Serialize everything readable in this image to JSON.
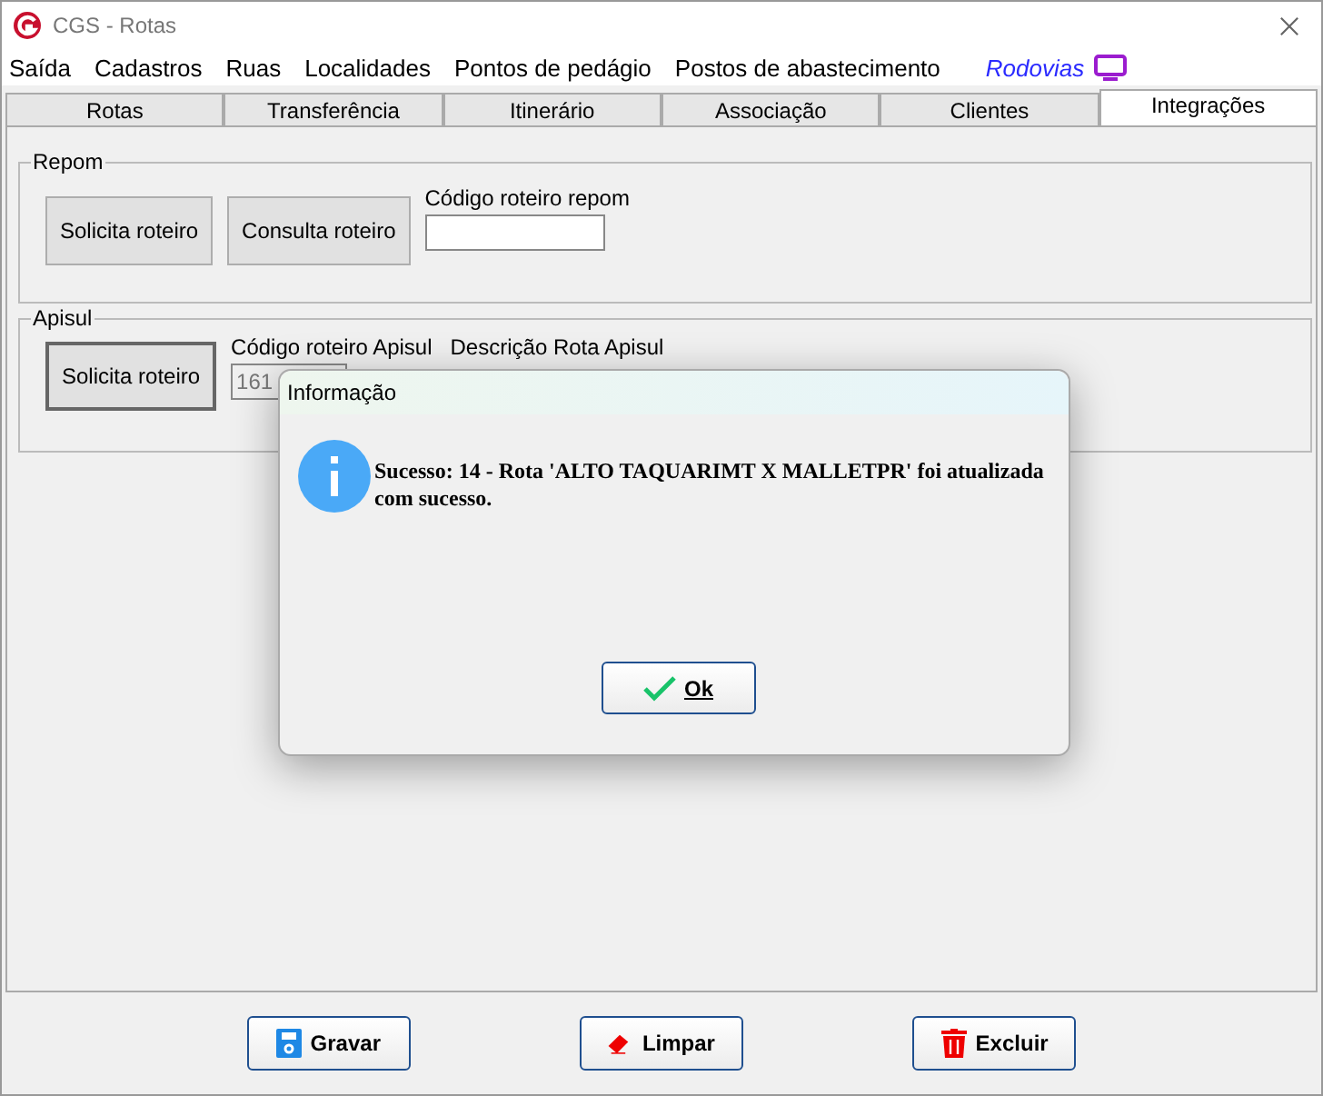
{
  "window": {
    "title": "CGS - Rotas"
  },
  "menu": [
    {
      "label": "Saída",
      "kind": "plain"
    },
    {
      "label": "Cadastros",
      "kind": "plain"
    },
    {
      "label": "Ruas",
      "kind": "plain"
    },
    {
      "label": "Localidades",
      "kind": "plain"
    },
    {
      "label": "Pontos de pedágio",
      "kind": "plain"
    },
    {
      "label": "Postos de abastecimento",
      "kind": "plain"
    },
    {
      "label": "Rodovias",
      "kind": "link"
    }
  ],
  "tabs": [
    {
      "label": "Rotas",
      "selected": false
    },
    {
      "label": "Transferência",
      "selected": false
    },
    {
      "label": "Itinerário",
      "selected": false
    },
    {
      "label": "Associação",
      "selected": false
    },
    {
      "label": "Clientes",
      "selected": false
    },
    {
      "label": "Integrações",
      "selected": true
    }
  ],
  "repom": {
    "title": "Repom",
    "buttons": [
      "Solicita roteiro",
      "Consulta roteiro"
    ],
    "field_label": "Código roteiro repom"
  },
  "apisul": {
    "title": "Apisul",
    "button": "Solicita roteiro",
    "code_label": "Código roteiro Apisul",
    "description_label": "Descrição Rota Apisul",
    "code_value": "161"
  },
  "dialog": {
    "title": "Informação",
    "message": "Sucesso: 14 - Rota 'ALTO TAQUARIMT X MALLETPR' foi atualizada com sucesso.",
    "button": "Ok"
  },
  "actions": [
    {
      "label": "Gravar",
      "kind": "save"
    },
    {
      "label": "Limpar",
      "kind": "clear"
    },
    {
      "label": "Excluir",
      "kind": "delete"
    }
  ]
}
